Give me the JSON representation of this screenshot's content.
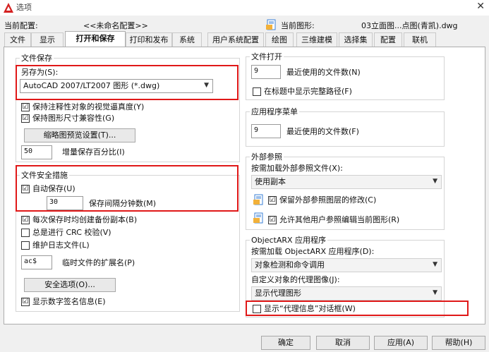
{
  "window": {
    "title": "选项",
    "close_glyph": "✕"
  },
  "header": {
    "current_profile_label": "当前配置:",
    "current_profile_value": "<<未命名配置>>",
    "current_drawing_label": "当前图形:",
    "current_drawing_value": "03立面图...点图(青凯).dwg"
  },
  "tabs": [
    {
      "label": "文件"
    },
    {
      "label": "显示"
    },
    {
      "label": "打开和保存"
    },
    {
      "label": "打印和发布"
    },
    {
      "label": "系统"
    },
    {
      "label": "用户系统配置"
    },
    {
      "label": "绘图"
    },
    {
      "label": "三维建模"
    },
    {
      "label": "选择集"
    },
    {
      "label": "配置"
    },
    {
      "label": "联机"
    }
  ],
  "active_tab": "打开和保存",
  "file_save": {
    "title": "文件保存",
    "save_as_label": "另存为(S):",
    "save_as_value": "AutoCAD 2007/LT2007 图形 (*.dwg)",
    "keep_annotative_label": "保持注释性对象的视觉逼真度(Y)",
    "keep_annotative_checked": "☑",
    "keep_drawing_size_label": "保持图形尺寸兼容性(G)",
    "keep_drawing_size_checked": "☑",
    "thumbnail_button": "缩略图预览设置(T)...",
    "incremental_value": "50",
    "incremental_label": "增量保存百分比(I)"
  },
  "file_safety": {
    "title": "文件安全措施",
    "autosave_label": "自动保存(U)",
    "autosave_checked": "☑",
    "interval_value": "30",
    "interval_label": "保存间隔分钟数(M)",
    "backup_label": "每次保存时均创建备份副本(B)",
    "backup_checked": "☑",
    "crc_label": "总是进行 CRC 校验(V)",
    "crc_checked": "",
    "log_label": "维护日志文件(L)",
    "log_checked": "",
    "temp_ext_value": "ac$",
    "temp_ext_label": "临时文件的扩展名(P)",
    "security_button": "安全选项(O)...",
    "digital_sig_label": "显示数字签名信息(E)",
    "digital_sig_checked": "☑"
  },
  "file_open": {
    "title": "文件打开",
    "recent_value": "9",
    "recent_label": "最近使用的文件数(N)",
    "full_path_label": "在标题中显示完整路径(F)",
    "full_path_checked": ""
  },
  "app_menu": {
    "title": "应用程序菜单",
    "recent_value": "9",
    "recent_label": "最近使用的文件数(F)"
  },
  "xref": {
    "title": "外部参照",
    "demand_load_label": "按需加载外部参照文件(X):",
    "demand_load_value": "使用副本",
    "retain_label": "保留外部参照图层的修改(C)",
    "retain_checked": "☑",
    "allow_edit_label": "允许其他用户参照编辑当前图形(R)",
    "allow_edit_checked": "☑"
  },
  "objectarx": {
    "title": "ObjectARX 应用程序",
    "demand_load_label": "按需加载 ObjectARX 应用程序(D):",
    "demand_load_value": "对象检测和命令调用",
    "proxy_label": "自定义对象的代理图像(J):",
    "proxy_value": "显示代理图形",
    "proxy_dialog_label": "显示“代理信息”对话框(W)",
    "proxy_dialog_checked": ""
  },
  "buttons": {
    "ok": "确定",
    "cancel": "取消",
    "apply": "应用(A)",
    "help": "帮助(H)"
  },
  "colors": {
    "highlight": "#e01818",
    "logo": "#d42020",
    "drawing_icon": "#3a7fd6"
  }
}
